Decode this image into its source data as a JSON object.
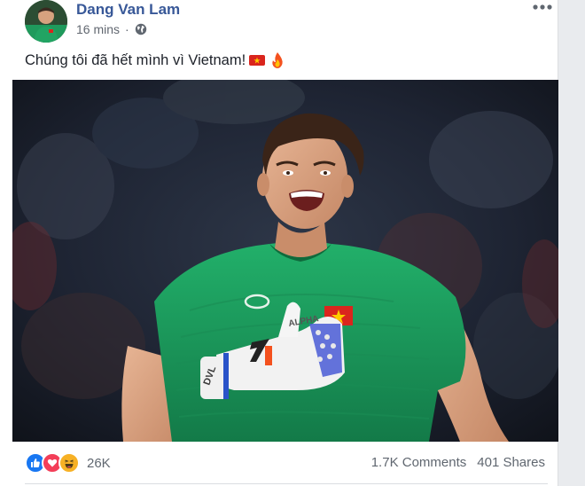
{
  "post": {
    "author": "Dang Van Lam",
    "time": "16 mins",
    "separator": "·",
    "privacy_icon": "globe-icon",
    "text": "Chúng tôi đã hết mình vì Vietnam!",
    "text_emojis": [
      "vietnam-flag-icon",
      "fire-icon"
    ]
  },
  "photo": {
    "subject": "goalkeeper-in-green-jersey",
    "glove_text_1": "ALPHA",
    "glove_text_2": "DVL"
  },
  "footer": {
    "reaction_icons": [
      "like-icon",
      "love-icon",
      "haha-icon"
    ],
    "reaction_count": "26K",
    "comments": "1.7K Comments",
    "shares": "401 Shares"
  },
  "colors": {
    "author_link": "#385898",
    "like": "#1877f2",
    "love": "#f33e58",
    "haha": "#f7b125",
    "jersey": "#1f9a5c"
  }
}
